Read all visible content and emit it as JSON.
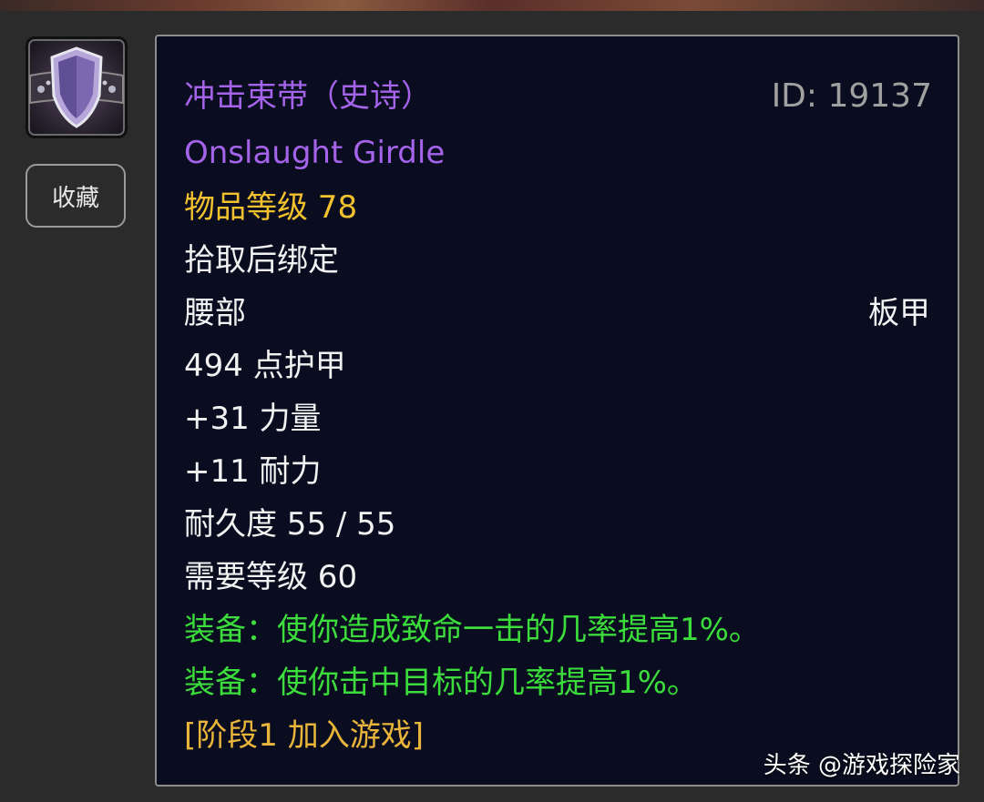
{
  "item": {
    "icon": "shield-belt-icon",
    "name_cn": "冲击束带（史诗）",
    "name_en": "Onslaught Girdle",
    "id_text": "ID: 19137",
    "item_level": "物品等级 78",
    "binding": "拾取后绑定",
    "slot": "腰部",
    "armor_type": "板甲",
    "armor": "494 点护甲",
    "stat_strength": "+31 力量",
    "stat_stamina": "+11 耐力",
    "durability": "耐久度 55 / 55",
    "required_level": "需要等级 60",
    "equip_effect_1": "装备：使你造成致命一击的几率提高1%。",
    "equip_effect_2": "装备：使你击中目标的几率提高1%。",
    "phase": "[阶段1 加入游戏]"
  },
  "actions": {
    "favorite_label": "收藏"
  },
  "watermark": {
    "text": "头条 @游戏探险家"
  },
  "colors": {
    "epic_purple": "#a463e8",
    "item_level_yellow": "#f2c12e",
    "equip_green": "#3bdc3b",
    "phase_gold": "#e9b53a",
    "tooltip_bg": "#0a0d20"
  }
}
